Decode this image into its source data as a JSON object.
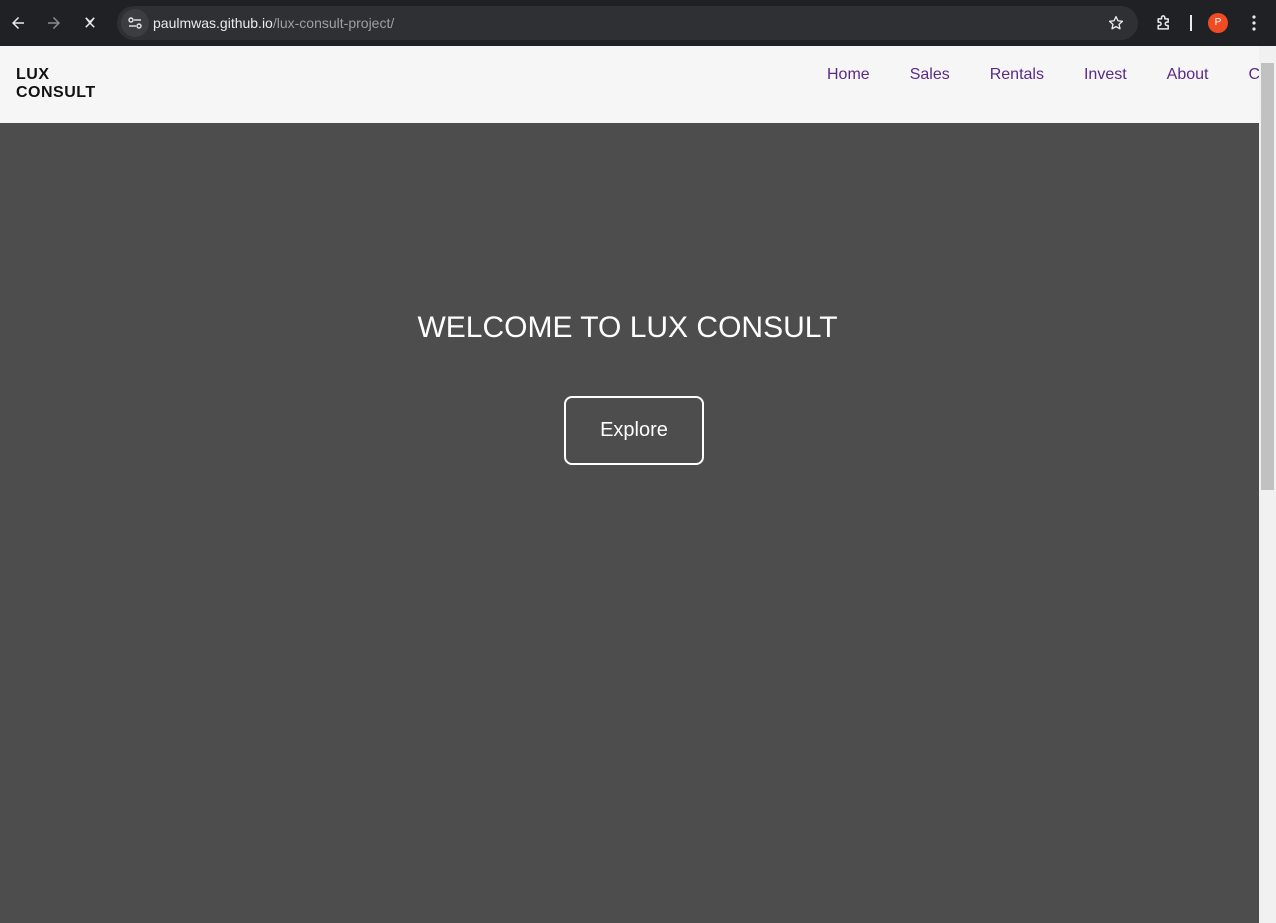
{
  "browser": {
    "url_host": "paulmwas.github.io",
    "url_path": "/lux-consult-project/",
    "profile_initial": "P",
    "icons": {
      "back": "back-arrow-icon",
      "forward": "forward-arrow-icon",
      "stop": "close-icon",
      "site_info": "site-settings-icon",
      "bookmark": "star-icon",
      "extensions": "puzzle-icon",
      "menu": "kebab-menu-icon"
    },
    "colors": {
      "chrome_bg": "#202124",
      "omnibox_bg": "#2f3033",
      "avatar": "#f04b23"
    }
  },
  "site": {
    "brand_line1": "LUX",
    "brand_line2": "CONSULT",
    "nav": [
      "Home",
      "Sales",
      "Rentals",
      "Invest",
      "About",
      "C"
    ],
    "colors": {
      "header_bg": "#f6f6f6",
      "nav_link": "#5b2a86",
      "hero_bg": "#4d4d4d"
    }
  },
  "hero": {
    "title": "WELCOME TO LUX CONSULT",
    "button_label": "Explore"
  }
}
